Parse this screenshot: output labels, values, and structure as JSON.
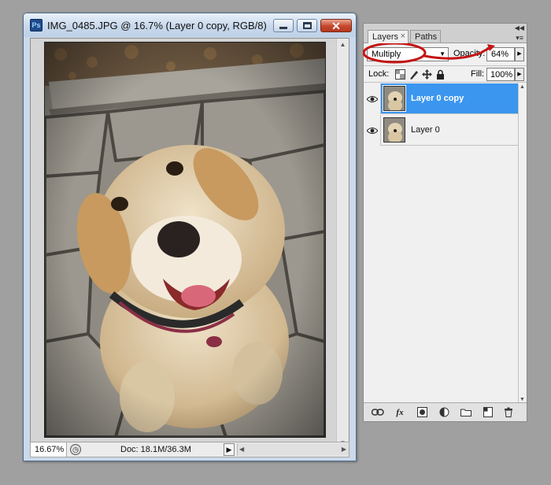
{
  "document": {
    "title": "IMG_0485.JPG @ 16.7% (Layer 0 copy, RGB/8)",
    "app_icon_label": "Ps",
    "zoom": "16.67%",
    "doc_info": "Doc: 18.1M/36.3M"
  },
  "layers_panel": {
    "tabs": [
      {
        "label": "Layers"
      },
      {
        "label": "Paths"
      }
    ],
    "blend_mode": "Multiply",
    "opacity_label": "Opacity:",
    "opacity_value": "64%",
    "lock_label": "Lock:",
    "fill_label": "Fill:",
    "fill_value": "100%",
    "layers": [
      {
        "name": "Layer 0 copy",
        "selected": true,
        "visible": true
      },
      {
        "name": "Layer 0",
        "selected": false,
        "visible": true
      }
    ],
    "bottom_buttons": [
      "link-layers-icon",
      "layer-style-icon",
      "layer-mask-icon",
      "adjustment-layer-icon",
      "new-group-icon",
      "new-layer-icon",
      "delete-layer-icon"
    ],
    "annotation_color": "#c41414",
    "selection_color": "#3b96ef"
  }
}
